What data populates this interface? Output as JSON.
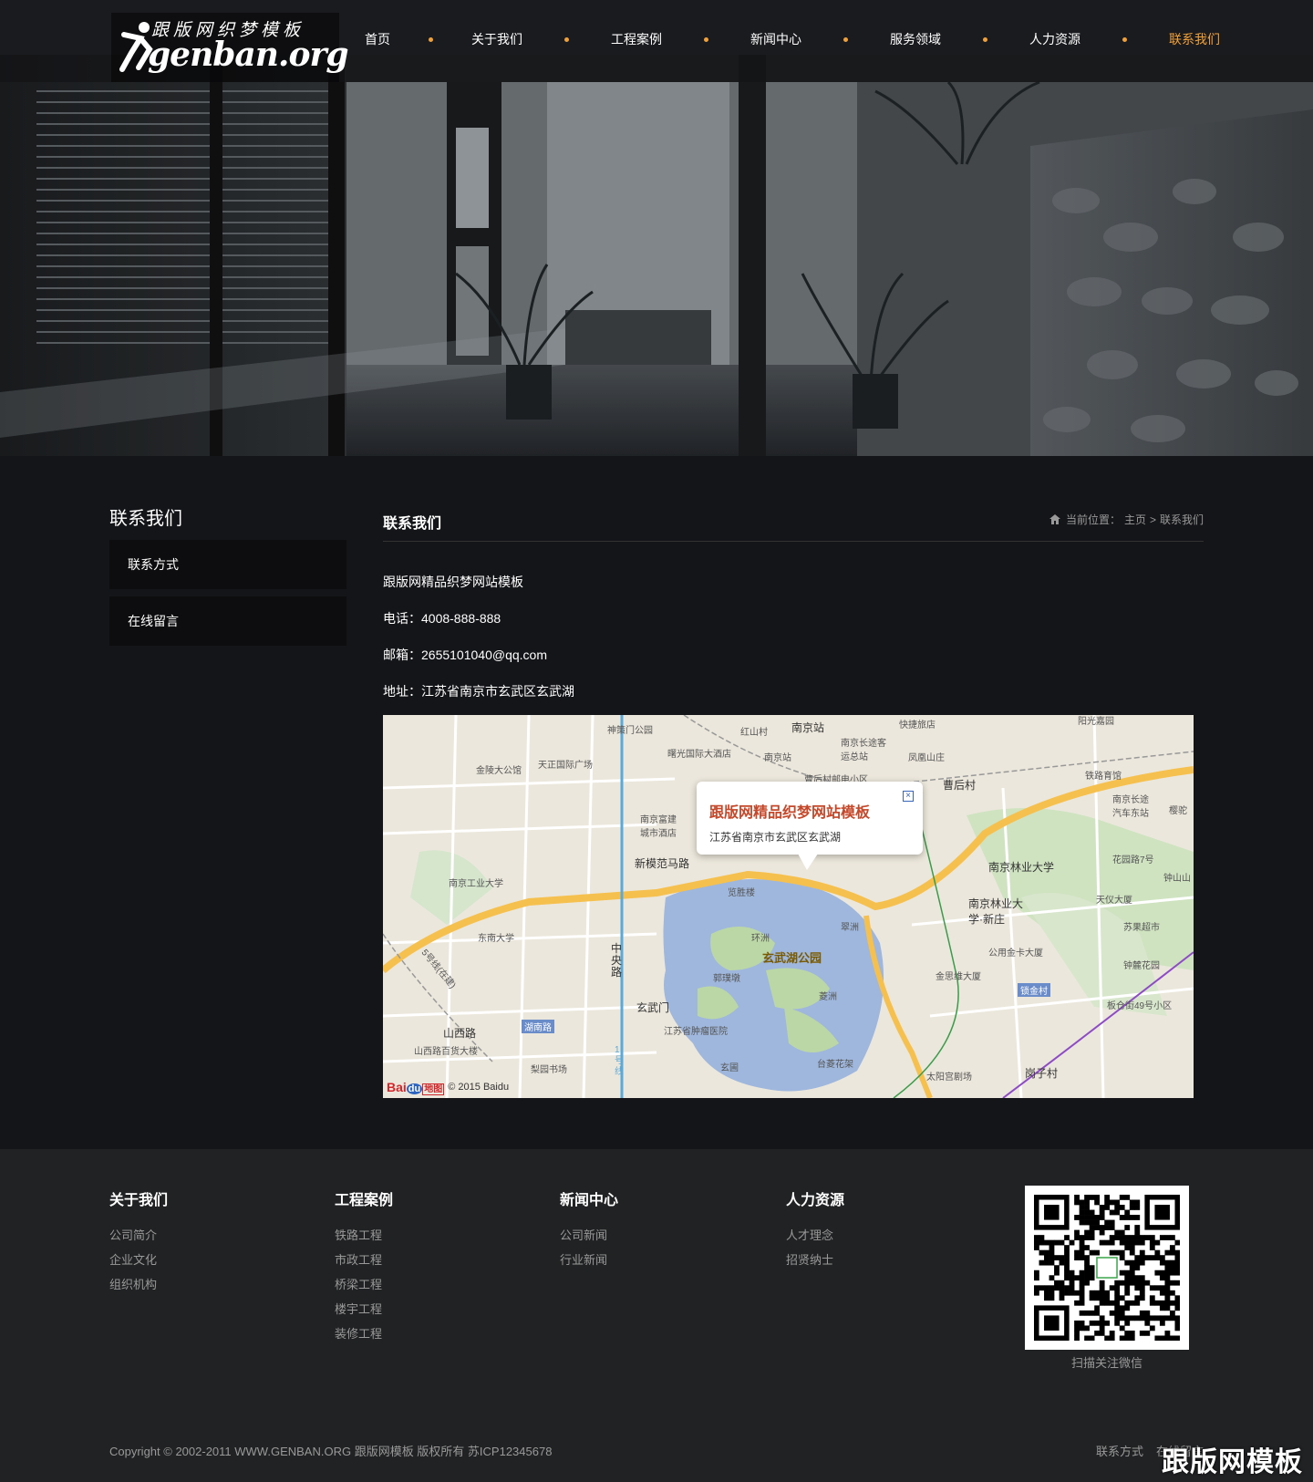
{
  "header": {
    "logo_zh": "跟版网织梦模板",
    "logo_en": "genban.org",
    "nav": [
      "首页",
      "关于我们",
      "工程案例",
      "新闻中心",
      "服务领域",
      "人力资源",
      "联系我们"
    ],
    "active_nav": "联系我们",
    "accent": "#f1a13a"
  },
  "sidebar": {
    "title": "联系我们",
    "items": [
      "联系方式",
      "在线留言"
    ]
  },
  "main": {
    "title": "联系我们",
    "breadcrumb": {
      "prefix": "当前位置：",
      "home": "主页",
      "sep": ">",
      "current": "联系我们"
    },
    "company": "跟版网精品织梦网站模板",
    "phone": "电话：4008-888-888",
    "email": "邮箱：2655101040@qq.com",
    "address": "地址：江苏省南京市玄武区玄武湖"
  },
  "map": {
    "popup_title": "跟版网精品织梦网站模板",
    "popup_address": "江苏省南京市玄武区玄武湖",
    "copyright": "© 2015 Baidu",
    "brand": "Bai",
    "brand_du": "du",
    "brand_map": "地图",
    "labels": [
      "南京站",
      "神策门公园",
      "红山村",
      "快捷旅店",
      "阳光嘉园",
      "曙光国际大酒店",
      "南京站",
      "南京长途客运总站",
      "凤凰山庄",
      "金陵大公馆",
      "天正国际广场",
      "曹后村邮电小区",
      "曹后村",
      "铁路育馆",
      "南京长途汽车东站",
      "樱驼",
      "南京富建城市酒店",
      "新模范马路",
      "南京林业大学",
      "花园路7号",
      "钟山山",
      "南京工业大学",
      "览胜楼",
      "南京林业大学·新庄",
      "天仪大厦",
      "东南大学",
      "环洲",
      "翠洲",
      "苏果超市",
      "公用金卡大厦",
      "玄武湖公园",
      "中央路",
      "钟麓花园",
      "郭璞墩",
      "金思维大厦",
      "锁金村",
      "菱洲",
      "板仓街49号小区",
      "玄武门",
      "湖南路",
      "江苏省肿瘤医院",
      "山西路",
      "山西路百货大楼",
      "梨园书场",
      "玄圃",
      "台菱花架",
      "太阳宫剧场",
      "岗子村",
      "1号线",
      "5号线(在建)"
    ]
  },
  "footer": {
    "columns": [
      {
        "title": "关于我们",
        "links": [
          "公司简介",
          "企业文化",
          "组织机构"
        ]
      },
      {
        "title": "工程案例",
        "links": [
          "铁路工程",
          "市政工程",
          "桥梁工程",
          "楼宇工程",
          "装修工程"
        ]
      },
      {
        "title": "新闻中心",
        "links": [
          "公司新闻",
          "行业新闻"
        ]
      },
      {
        "title": "人力资源",
        "links": [
          "人才理念",
          "招贤纳士"
        ]
      }
    ],
    "qr_caption": "扫描关注微信",
    "copyright": "Copyright © 2002-2011 WWW.GENBAN.ORG 跟版网模板 版权所有   苏ICP12345678",
    "bottom_links": [
      "联系方式",
      "在线留言"
    ],
    "watermark": "跟版网模板"
  }
}
